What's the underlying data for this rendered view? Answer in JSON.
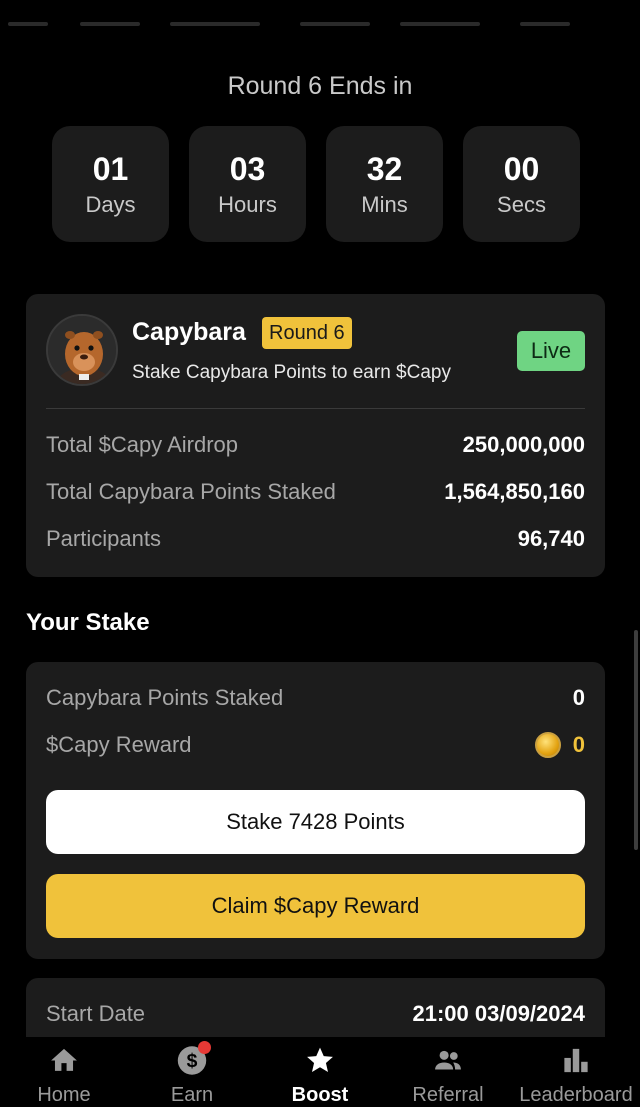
{
  "round_title": "Round 6 Ends in",
  "countdown": [
    {
      "value": "01",
      "label": "Days"
    },
    {
      "value": "03",
      "label": "Hours"
    },
    {
      "value": "32",
      "label": "Mins"
    },
    {
      "value": "00",
      "label": "Secs"
    }
  ],
  "pool": {
    "name": "Capybara",
    "round_badge": "Round 6",
    "description": "Stake Capybara Points to earn $Capy",
    "status": "Live",
    "stats": [
      {
        "label": "Total $Capy Airdrop",
        "value": "250,000,000"
      },
      {
        "label": "Total Capybara Points Staked",
        "value": "1,564,850,160"
      },
      {
        "label": "Participants",
        "value": "96,740"
      }
    ]
  },
  "your_stake": {
    "title": "Your Stake",
    "points_staked_label": "Capybara Points Staked",
    "points_staked_value": "0",
    "reward_label": "$Capy Reward",
    "reward_value": "0",
    "reward_icon": "coin-icon",
    "stake_button": "Stake 7428 Points",
    "claim_button": "Claim $Capy Reward"
  },
  "schedule": {
    "start_label": "Start Date",
    "start_value": "21:00 03/09/2024"
  },
  "nav": [
    {
      "label": "Home",
      "icon": "home-icon"
    },
    {
      "label": "Earn",
      "icon": "dollar-icon"
    },
    {
      "label": "Boost",
      "icon": "star-icon",
      "active": true
    },
    {
      "label": "Referral",
      "icon": "people-icon"
    },
    {
      "label": "Leaderboard",
      "icon": "bar-chart-icon"
    }
  ],
  "colors": {
    "accent": "#f0c23b",
    "live": "#6fd483",
    "card": "#1c1c1c",
    "background": "#000000",
    "notification": "#e53935"
  }
}
